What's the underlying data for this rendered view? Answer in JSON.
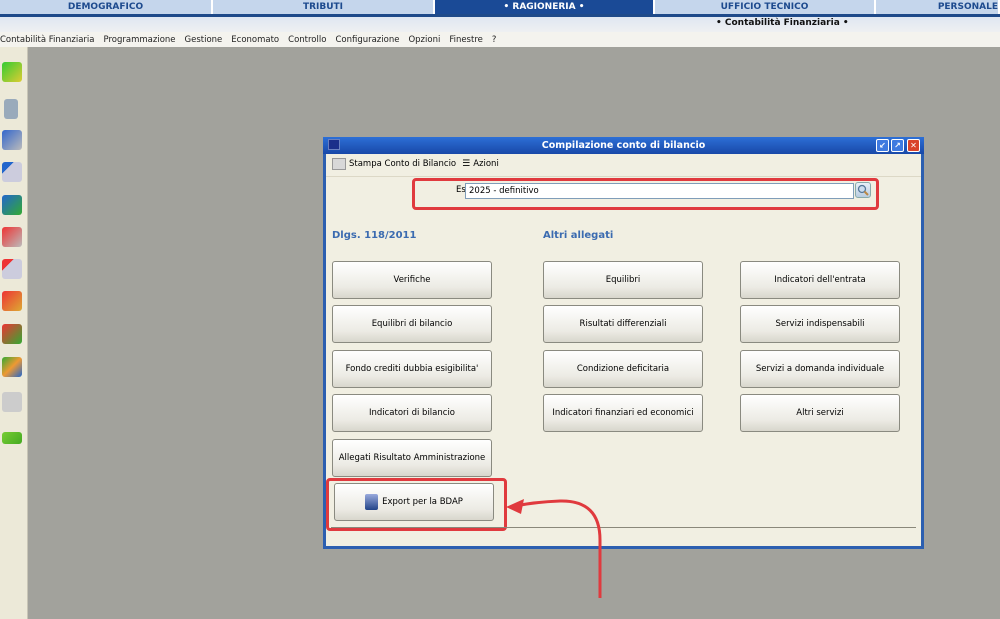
{
  "top_tabs": [
    "DEMOGRAFICO",
    "TRIBUTI",
    "• RAGIONERIA •",
    "UFFICIO TECNICO",
    "PERSONALE"
  ],
  "sub_module": "• Contabilità Finanziaria •",
  "menu": [
    "Contabilità Finanziaria",
    "Programmazione",
    "Gestione",
    "Economato",
    "Controllo",
    "Configurazione",
    "Opzioni",
    "Finestre",
    "?"
  ],
  "dialog": {
    "title": "Compilazione conto di bilancio",
    "toolbar": {
      "print": "Stampa Conto di Bilancio",
      "actions": "Azioni"
    },
    "esercizio_label": "Esercizio",
    "esercizio_value": "2025 - definitivo",
    "section_left": "Dlgs. 118/2011",
    "section_right": "Altri allegati",
    "col1": [
      "Verifiche",
      "Equilibri di bilancio",
      "Fondo crediti dubbia esigibilita'",
      "Indicatori di bilancio",
      "Allegati Risultato Amministrazione"
    ],
    "col2": [
      "Equilibri",
      "Risultati differenziali",
      "Condizione deficitaria",
      "Indicatori finanziari ed economici"
    ],
    "col3": [
      "Indicatori dell'entrata",
      "Servizi indispensabili",
      "Servizi a domanda individuale",
      "Altri servizi"
    ],
    "export": "Export per la BDAP"
  },
  "colors": {
    "accent": "#1a4a96",
    "highlight": "#e03a3e"
  }
}
